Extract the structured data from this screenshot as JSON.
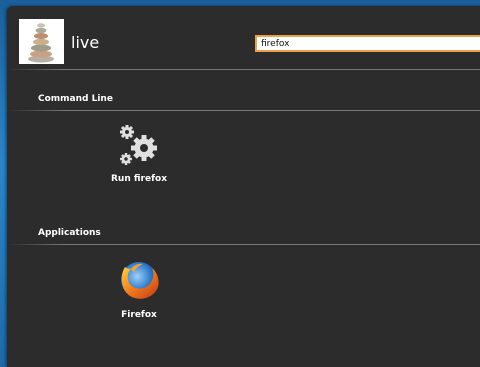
{
  "user": {
    "name": "live"
  },
  "search": {
    "value": "firefox"
  },
  "sections": [
    {
      "title": "Command Line",
      "items": [
        {
          "label": "Run firefox",
          "icon": "gears-icon"
        }
      ]
    },
    {
      "title": "Applications",
      "items": [
        {
          "label": "Firefox",
          "icon": "firefox-icon"
        }
      ]
    }
  ],
  "colors": {
    "panel": "#2c2c2c",
    "search_border": "#e9a248",
    "desktop": "#2a86cc"
  }
}
